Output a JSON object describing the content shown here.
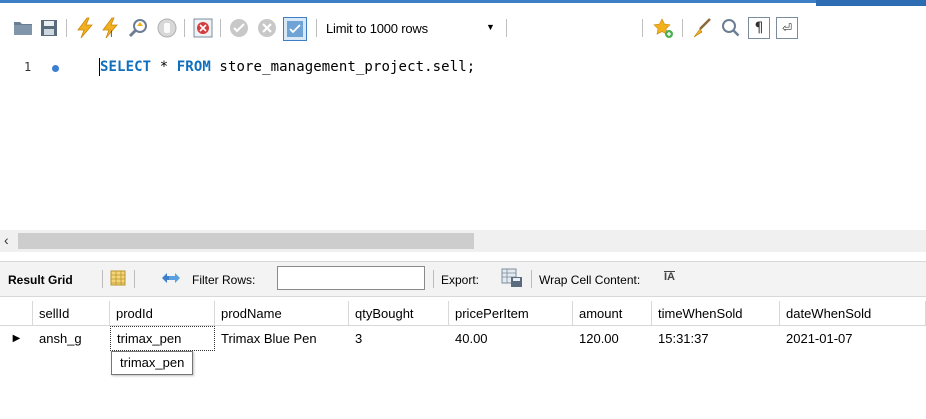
{
  "toolbar": {
    "limit_label": "Limit to 1000 rows",
    "icons": [
      "open-folder-icon",
      "save-icon",
      "execute-icon",
      "execute-current-icon",
      "explain-icon",
      "stop-icon",
      "toggle-error-icon",
      "commit-icon",
      "rollback-icon",
      "autocommit-icon",
      "beautify-icon",
      "find-icon",
      "invisible-chars-icon",
      "wrap-icon",
      "bookmark-icon"
    ]
  },
  "editor": {
    "line_number": "1",
    "keyword_select": "SELECT",
    "star": " * ",
    "keyword_from": "FROM",
    "table_ref": " store_management_project.sell;"
  },
  "result_bar": {
    "result_grid": "Result Grid",
    "filter_rows": "Filter Rows:",
    "filter_value": "",
    "export": "Export:",
    "wrap_cell": "Wrap Cell Content:"
  },
  "grid": {
    "columns": [
      "sellId",
      "prodId",
      "prodName",
      "qtyBought",
      "pricePerItem",
      "amount",
      "timeWhenSold",
      "dateWhenSold"
    ],
    "rows": [
      [
        "ansh_g",
        "trimax_pen",
        "Trimax Blue Pen",
        "3",
        "40.00",
        "120.00",
        "15:31:37",
        "2021-01-07"
      ]
    ]
  },
  "tooltip": "trimax_pen",
  "colors": {
    "accent": "#3c7fc6",
    "keyword": "#0f6fbf",
    "lightning": "#f2b01e"
  }
}
